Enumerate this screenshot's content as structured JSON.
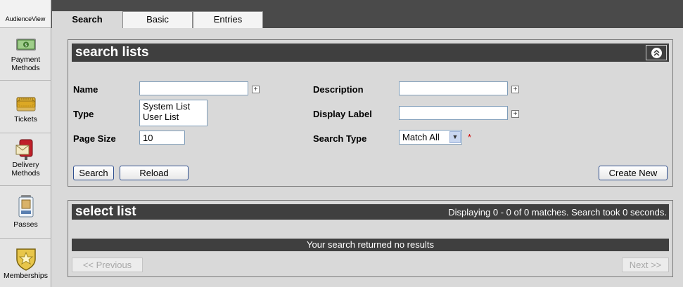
{
  "app": {
    "brand": "AudienceView"
  },
  "sidebar": {
    "items": [
      {
        "label1": "Payment",
        "label2": "Methods"
      },
      {
        "label1": "Tickets",
        "label2": ""
      },
      {
        "label1": "Delivery",
        "label2": "Methods"
      },
      {
        "label1": "Passes",
        "label2": ""
      },
      {
        "label1": "Memberships",
        "label2": ""
      }
    ]
  },
  "tabs": [
    {
      "label": "Search",
      "active": true
    },
    {
      "label": "Basic",
      "active": false
    },
    {
      "label": "Entries",
      "active": false
    }
  ],
  "search_panel": {
    "title": "search lists",
    "fields": {
      "name_label": "Name",
      "name_value": "",
      "type_label": "Type",
      "type_options": [
        "System List",
        "User List"
      ],
      "page_size_label": "Page Size",
      "page_size_value": "10",
      "description_label": "Description",
      "description_value": "",
      "display_label_label": "Display Label",
      "display_label_value": "",
      "search_type_label": "Search Type",
      "search_type_value": "Match All",
      "required_mark": "*"
    },
    "buttons": {
      "search": "Search",
      "reload": "Reload",
      "create_new": "Create New"
    }
  },
  "select_panel": {
    "title": "select list",
    "info": "Displaying 0 - 0 of 0 matches. Search took 0 seconds.",
    "empty_message": "Your search returned no results",
    "previous": "<< Previous",
    "next": "Next >>"
  },
  "colors": {
    "header_dark": "#3f3f3f",
    "topbar": "#4a4a4a",
    "panel_bg": "#d9d9d9",
    "required": "#d00000"
  }
}
